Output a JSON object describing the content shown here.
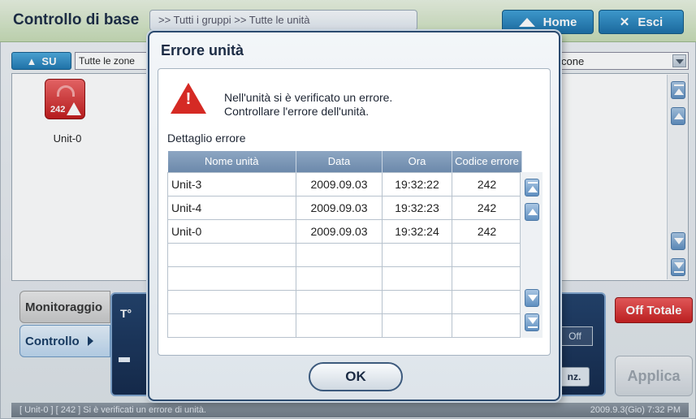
{
  "header": {
    "title": "Controllo di base",
    "breadcrumb": ">> Tutti i gruppi >> Tutte le unità",
    "home_label": "Home",
    "exit_label": "Esci"
  },
  "toolbar": {
    "up_label": "SU",
    "zone_value": "Tutte le zone",
    "right_select_value": "cone"
  },
  "units": [
    {
      "name": "Unit-0",
      "code": "242",
      "status": "error",
      "icon": "air-conditioner-icon"
    }
  ],
  "tabs": {
    "monitor": "Monitoraggio",
    "control": "Controllo"
  },
  "controls": {
    "temp_label": "T°",
    "off_label": "Off",
    "inz_label": "nz.",
    "off_totale": "Off Totale",
    "applica": "Applica"
  },
  "status_bar": {
    "message": "[ Unit-0 ] [ 242 ] Si è verificati un errore di unità.",
    "datetime": "2009.9.3(Gio)  7:32 PM"
  },
  "dialog": {
    "title": "Errore unità",
    "message_line1": "Nell'unità si è verificato un errore.",
    "message_line2": "Controllare l'errore dell'unità.",
    "detail_label": "Dettaglio errore",
    "columns": [
      "Nome unità",
      "Data",
      "Ora",
      "Codice errore"
    ],
    "rows": [
      [
        "Unit-3",
        "2009.09.03",
        "19:32:22",
        "242"
      ],
      [
        "Unit-4",
        "2009.09.03",
        "19:32:23",
        "242"
      ],
      [
        "Unit-0",
        "2009.09.03",
        "19:32:24",
        "242"
      ],
      [
        "",
        "",
        "",
        ""
      ],
      [
        "",
        "",
        "",
        ""
      ],
      [
        "",
        "",
        "",
        ""
      ],
      [
        "",
        "",
        "",
        ""
      ]
    ],
    "ok_label": "OK"
  },
  "colors": {
    "accent": "#1f77b0",
    "error": "#d52a24",
    "panel_dark": "#13294b"
  }
}
